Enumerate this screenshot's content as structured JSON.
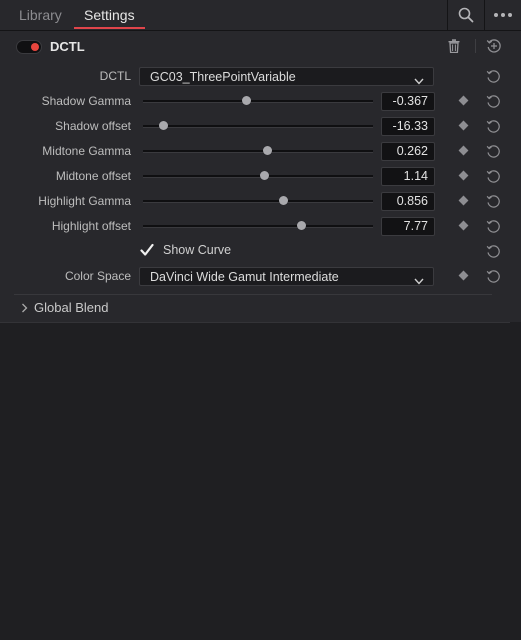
{
  "tabs": [
    {
      "label": "Library"
    },
    {
      "label": "Settings"
    }
  ],
  "topbar_icons": {
    "search": "search-icon",
    "more": "more-options-icon"
  },
  "dctl": {
    "title": "DCTL",
    "enabled": true,
    "dctl_label": "DCTL",
    "dctl_value": "GC03_ThreePointVariable"
  },
  "params": [
    {
      "label": "Shadow Gamma",
      "value": "-0.367",
      "slider_fraction": 0.45
    },
    {
      "label": "Shadow offset",
      "value": "-16.33",
      "slider_fraction": 0.09
    },
    {
      "label": "Midtone Gamma",
      "value": "0.262",
      "slider_fraction": 0.54
    },
    {
      "label": "Midtone offset",
      "value": "1.14",
      "slider_fraction": 0.53
    },
    {
      "label": "Highlight Gamma",
      "value": "0.856",
      "slider_fraction": 0.61
    },
    {
      "label": "Highlight offset",
      "value": "7.77",
      "slider_fraction": 0.69
    }
  ],
  "show_curve": {
    "label": "Show Curve",
    "checked": true
  },
  "color_space": {
    "label": "Color Space",
    "value": "DaVinci Wide Gamut Intermediate"
  },
  "global_blend": {
    "label": "Global Blend",
    "expanded": false
  }
}
